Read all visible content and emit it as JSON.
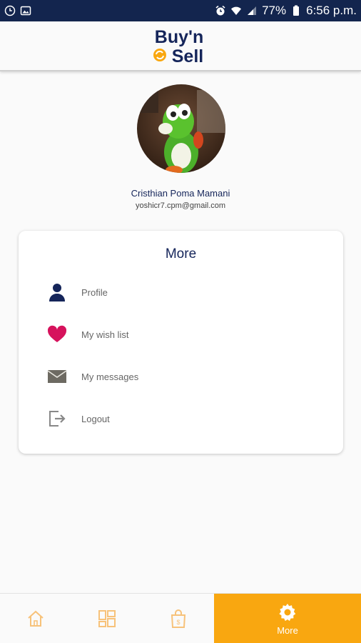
{
  "status_bar": {
    "battery": "77%",
    "time": "6:56 p.m."
  },
  "header": {
    "logo_line1": "Buy'n",
    "logo_line2": "Sell"
  },
  "profile": {
    "name": "Cristhian Poma Mamani",
    "email": "yoshicr7.cpm@gmail.com"
  },
  "menu": {
    "title": "More",
    "items": [
      {
        "label": "Profile",
        "icon": "person-icon"
      },
      {
        "label": "My wish list",
        "icon": "heart-icon"
      },
      {
        "label": "My messages",
        "icon": "envelope-icon"
      },
      {
        "label": "Logout",
        "icon": "logout-icon"
      }
    ]
  },
  "bottom_nav": {
    "items": [
      {
        "icon": "home-icon",
        "label": ""
      },
      {
        "icon": "grid-icon",
        "label": ""
      },
      {
        "icon": "shopping-bag-icon",
        "label": ""
      },
      {
        "icon": "gear-icon",
        "label": "More",
        "active": true
      }
    ]
  },
  "colors": {
    "status_bar": "#13254e",
    "accent": "#f9a710",
    "navy": "#15255a",
    "heart": "#d6125c"
  }
}
